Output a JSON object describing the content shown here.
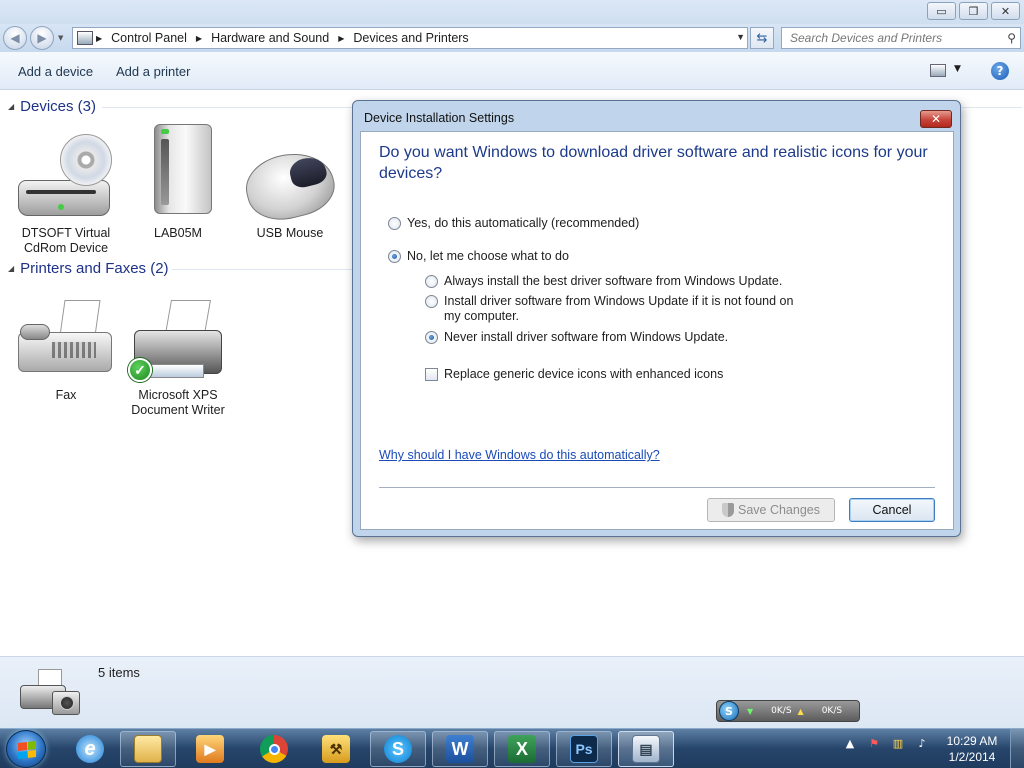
{
  "window": {
    "minimize_glyph": "▭",
    "maximize_glyph": "❐",
    "close_glyph": "✕"
  },
  "address": {
    "segments": [
      "Control Panel",
      "Hardware and Sound",
      "Devices and Printers"
    ],
    "search_placeholder": "Search Devices and Printers"
  },
  "commands": {
    "add_device": "Add a device",
    "add_printer": "Add a printer",
    "help": "?"
  },
  "devices_group": {
    "title": "Devices (3)",
    "items": [
      {
        "label": "DTSOFT Virtual CdRom Device",
        "icon": "cd-drive-icon"
      },
      {
        "label": "LAB05M",
        "icon": "computer-tower-icon"
      },
      {
        "label": "USB Mouse",
        "icon": "mouse-icon"
      }
    ]
  },
  "printers_group": {
    "title": "Printers and Faxes (2)",
    "items": [
      {
        "label": "Fax",
        "icon": "fax-icon"
      },
      {
        "label": "Microsoft XPS Document Writer",
        "icon": "printer-icon",
        "default": true
      }
    ]
  },
  "details": {
    "count": "5 items"
  },
  "dialog": {
    "title": "Device Installation Settings",
    "question": "Do you want Windows to download driver software and realistic icons for your devices?",
    "option_yes": "Yes, do this automatically (recommended)",
    "option_no": "No, let me choose what to do",
    "sub_always": "Always install the best driver software from Windows Update.",
    "sub_install_if_missing": "Install driver software from Windows Update if it is not found on my computer.",
    "sub_never": "Never install driver software from Windows Update.",
    "replace_icons": "Replace generic device icons with enhanced icons",
    "link": "Why should I have Windows do this automatically?",
    "save": "Save Changes",
    "cancel": "Cancel",
    "selected_main": "no",
    "selected_sub": "never",
    "replace_icons_checked": false
  },
  "netmeter": {
    "down": "0K/S",
    "up": "0K/S"
  },
  "taskbar": {
    "time": "10:29 AM",
    "date": "1/2/2014",
    "apps": [
      "internet-explorer",
      "file-explorer",
      "media-player",
      "chrome",
      "tool-app",
      "skype",
      "word",
      "excel",
      "photoshop",
      "control-panel"
    ]
  },
  "colors": {
    "accent_blue": "#1d3a8a",
    "link_blue": "#1a4bb8",
    "group_header": "#1e3287"
  }
}
